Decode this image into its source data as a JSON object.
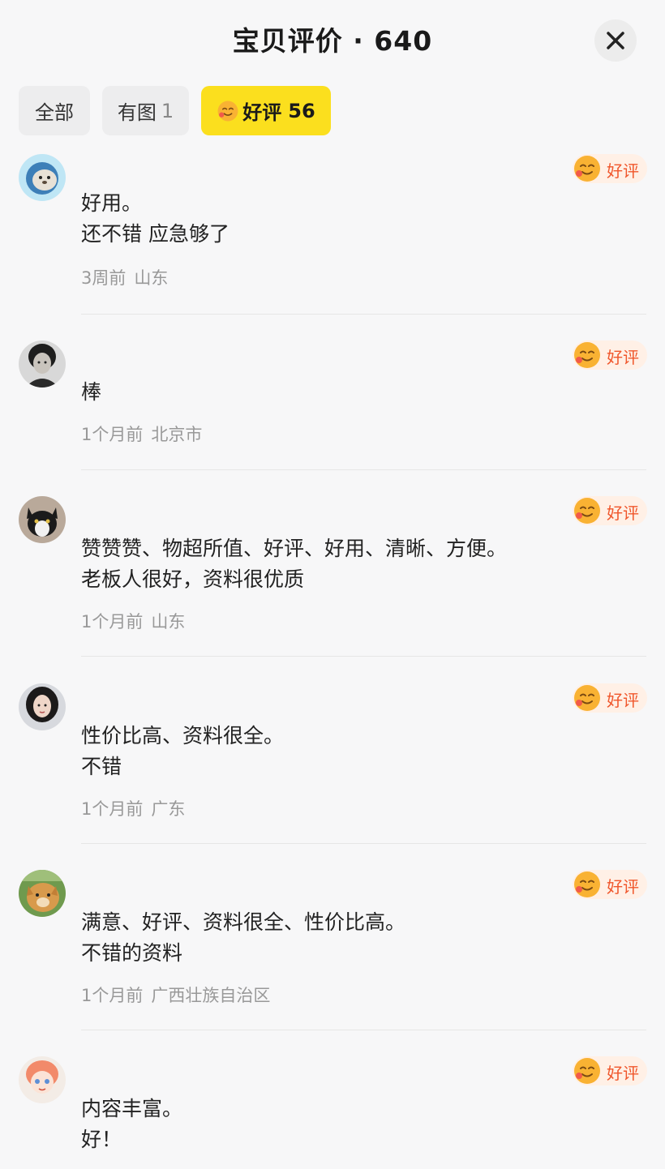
{
  "header": {
    "title": "宝贝评价 · 640"
  },
  "tabs": [
    {
      "label": "全部",
      "count": ""
    },
    {
      "label": "有图",
      "count": "1"
    },
    {
      "label": "好评",
      "count": "56"
    }
  ],
  "badge_label": "好评",
  "colors": {
    "active_tab": "#fbdf1e",
    "badge_bg": "#fff0e6",
    "badge_text": "#f0562b",
    "meta_text": "#999999"
  },
  "reviews": [
    {
      "line1": "好用。",
      "line2": "还不错 应急够了",
      "time": "3周前",
      "location": "山东",
      "avatar_icon": "seal-avatar"
    },
    {
      "line1": "棒",
      "line2": "",
      "time": "1个月前",
      "location": "北京市",
      "avatar_icon": "person-avatar"
    },
    {
      "line1": "赞赞赞、物超所值、好评、好用、清晰、方便。",
      "line2": "老板人很好，资料很优质",
      "time": "1个月前",
      "location": "山东",
      "avatar_icon": "cat-avatar"
    },
    {
      "line1": "性价比高、资料很全。",
      "line2": "不错",
      "time": "1个月前",
      "location": "广东",
      "avatar_icon": "girl-avatar"
    },
    {
      "line1": "满意、好评、资料很全、性价比高。",
      "line2": "不错的资料",
      "time": "1个月前",
      "location": "广西壮族自治区",
      "avatar_icon": "dog-avatar"
    },
    {
      "line1": "内容丰富。",
      "line2": "好！",
      "time": "",
      "location": "",
      "avatar_icon": "cartoon-avatar"
    }
  ]
}
